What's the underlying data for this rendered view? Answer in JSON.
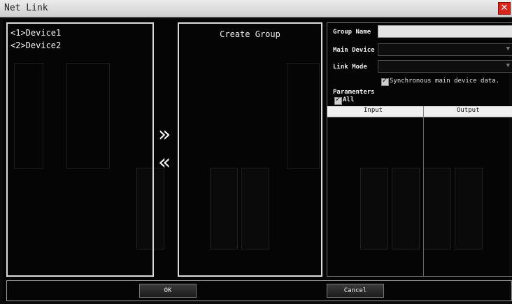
{
  "window": {
    "title": "Net Link",
    "close_glyph": "✕"
  },
  "device_list": {
    "items": [
      "<1>Device1",
      "<2>Device2"
    ]
  },
  "group": {
    "title": "Create Group"
  },
  "arrows": {
    "add": "»",
    "remove": "«"
  },
  "settings": {
    "group_name_label": "Group Name",
    "group_name_value": "",
    "main_device_label": "Main Device",
    "main_device_value": "",
    "link_mode_label": "Link Mode",
    "link_mode_value": "",
    "sync_checked": true,
    "sync_label": "Synchronous main device data.",
    "parameters_label": "Paramenters",
    "all_checked": true,
    "all_label": "All",
    "columns": [
      "Input",
      "Output"
    ]
  },
  "buttons": {
    "ok": "OK",
    "cancel": "Cancel"
  },
  "icons": [
    "close-icon",
    "arrow-right-icon",
    "arrow-left-icon",
    "checkbox-icon",
    "dropdown-caret-icon"
  ]
}
